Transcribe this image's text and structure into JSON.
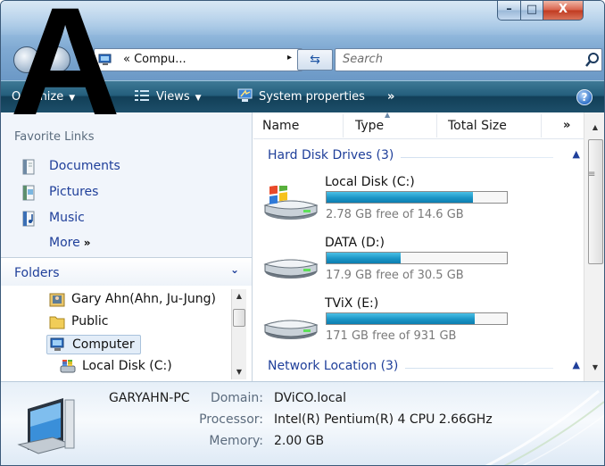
{
  "overlay": {
    "letter": "A"
  },
  "window": {
    "caption_buttons": {
      "minimize": "–",
      "maximize": "□",
      "close": "X"
    }
  },
  "address_bar": {
    "breadcrumb": "« Compu...",
    "chevron": "▸",
    "search_placeholder": "Search"
  },
  "toolbar": {
    "organize": "Organize",
    "views": "Views",
    "system_properties": "System properties",
    "more": "»",
    "help": "?"
  },
  "nav_pane": {
    "favorite_links_title": "Favorite Links",
    "favorites": [
      {
        "label": "Documents",
        "icon": "documents-icon"
      },
      {
        "label": "Pictures",
        "icon": "pictures-icon"
      },
      {
        "label": "Music",
        "icon": "music-icon"
      }
    ],
    "more_label": "More",
    "more_glyph": "»",
    "folders_label": "Folders",
    "folders_chevron": "⌄",
    "tree": [
      {
        "label": "Gary Ahn(Ahn, Ju-Jung)",
        "icon": "user-folder-icon"
      },
      {
        "label": "Public",
        "icon": "folder-icon"
      },
      {
        "label": "Computer",
        "icon": "computer-icon",
        "selected": true
      },
      {
        "label": "Local Disk (C:)",
        "icon": "local-disk-icon"
      }
    ]
  },
  "content": {
    "columns": {
      "name": "Name",
      "type": "Type",
      "total_size": "Total Size",
      "more": "»"
    },
    "groups": {
      "hard_disk": "Hard Disk Drives (3)",
      "network": "Network Location (3)"
    },
    "drives": [
      {
        "name": "Local Disk (C:)",
        "free_text": "2.78 GB free of 14.6 GB",
        "used_fraction": 0.81,
        "icon": "windows-drive-icon"
      },
      {
        "name": "DATA (D:)",
        "free_text": "17.9 GB free of 30.5 GB",
        "used_fraction": 0.41,
        "icon": "hard-drive-icon"
      },
      {
        "name": "TViX (E:)",
        "free_text": "171 GB free of 931 GB",
        "used_fraction": 0.82,
        "icon": "hard-drive-icon"
      }
    ]
  },
  "details": {
    "computer_name": "GARYAHN-PC",
    "domain_label": "Domain:",
    "domain_value": "DViCO.local",
    "processor_label": "Processor:",
    "processor_value": "Intel(R) Pentium(R) 4 CPU 2.66GHz",
    "memory_label": "Memory:",
    "memory_value": "2.00 GB"
  },
  "colors": {
    "toolbar": "#1d4f6a",
    "link": "#1f3f9a",
    "usage_bar": "#1b95c6",
    "close_button": "#c0391f"
  }
}
